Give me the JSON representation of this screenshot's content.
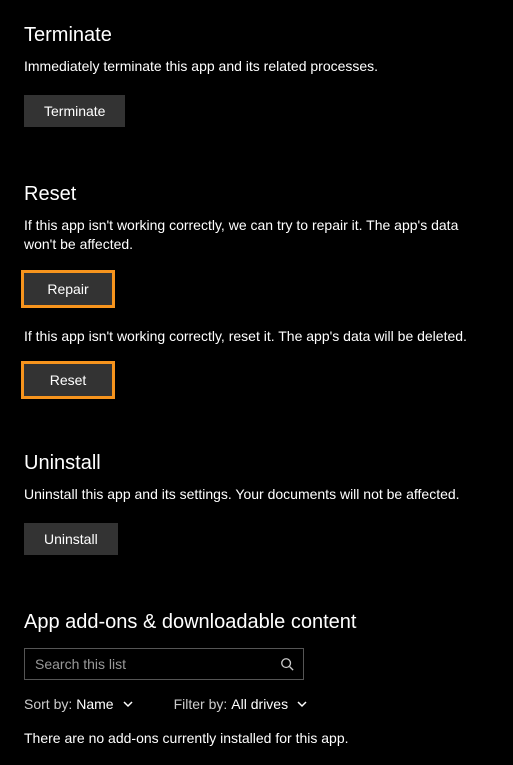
{
  "terminate": {
    "heading": "Terminate",
    "description": "Immediately terminate this app and its related processes.",
    "button_label": "Terminate"
  },
  "reset": {
    "heading": "Reset",
    "repair_description": "If this app isn't working correctly, we can try to repair it. The app's data won't be affected.",
    "repair_button_label": "Repair",
    "reset_description": "If this app isn't working correctly, reset it. The app's data will be deleted.",
    "reset_button_label": "Reset"
  },
  "uninstall": {
    "heading": "Uninstall",
    "description": "Uninstall this app and its settings. Your documents will not be affected.",
    "button_label": "Uninstall"
  },
  "addons": {
    "heading": "App add-ons & downloadable content",
    "search_placeholder": "Search this list",
    "sort_label": "Sort by:",
    "sort_value": "Name",
    "filter_label": "Filter by:",
    "filter_value": "All drives",
    "empty_message": "There are no add-ons currently installed for this app."
  },
  "colors": {
    "highlight": "#f7941d"
  }
}
